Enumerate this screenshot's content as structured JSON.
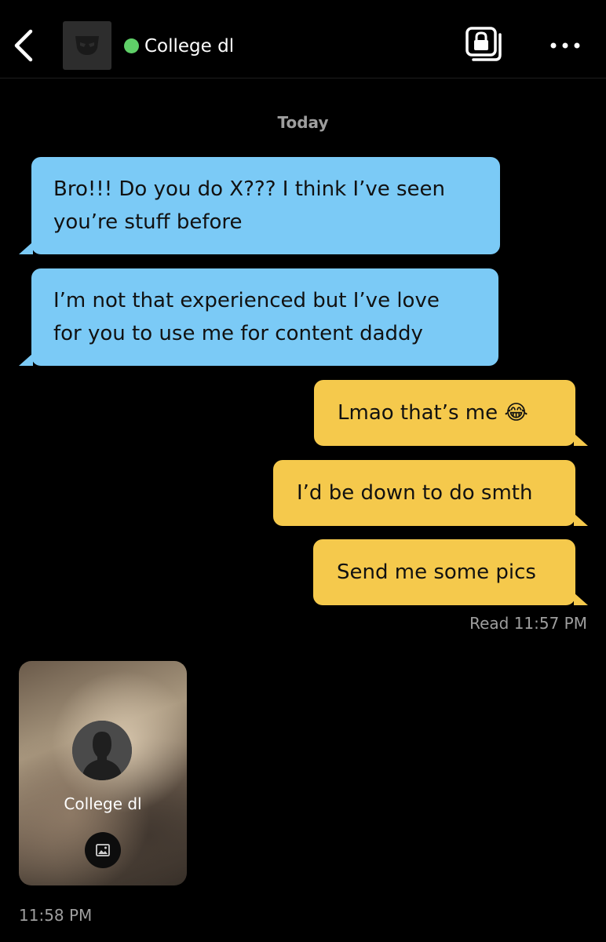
{
  "header": {
    "contact_name": "College dl",
    "online_color": "#5fd068",
    "back_icon": "chevron-left-icon",
    "album_icon": "locked-album-icon",
    "more_icon": "more-dots-icon"
  },
  "conversation": {
    "date_label": "Today",
    "messages": [
      {
        "direction": "incoming",
        "text": "Bro!!! Do you do X??? I think I’ve seen\nyou’re stuff before"
      },
      {
        "direction": "incoming",
        "text": "I’m not that experienced but I’ve love\nfor you to use me for content daddy"
      },
      {
        "direction": "outgoing",
        "text": "Lmao that’s me 😂"
      },
      {
        "direction": "outgoing",
        "text": "I’d be down to do smth"
      },
      {
        "direction": "outgoing",
        "text": "Send me some pics"
      }
    ],
    "read_receipt": "Read 11:57 PM",
    "profile_card": {
      "name": "College dl",
      "photo_icon": "image-icon",
      "time": "11:58 PM"
    }
  },
  "colors": {
    "incoming_bubble": "#7bcaf6",
    "outgoing_bubble": "#f5c94c",
    "background": "#000000"
  }
}
